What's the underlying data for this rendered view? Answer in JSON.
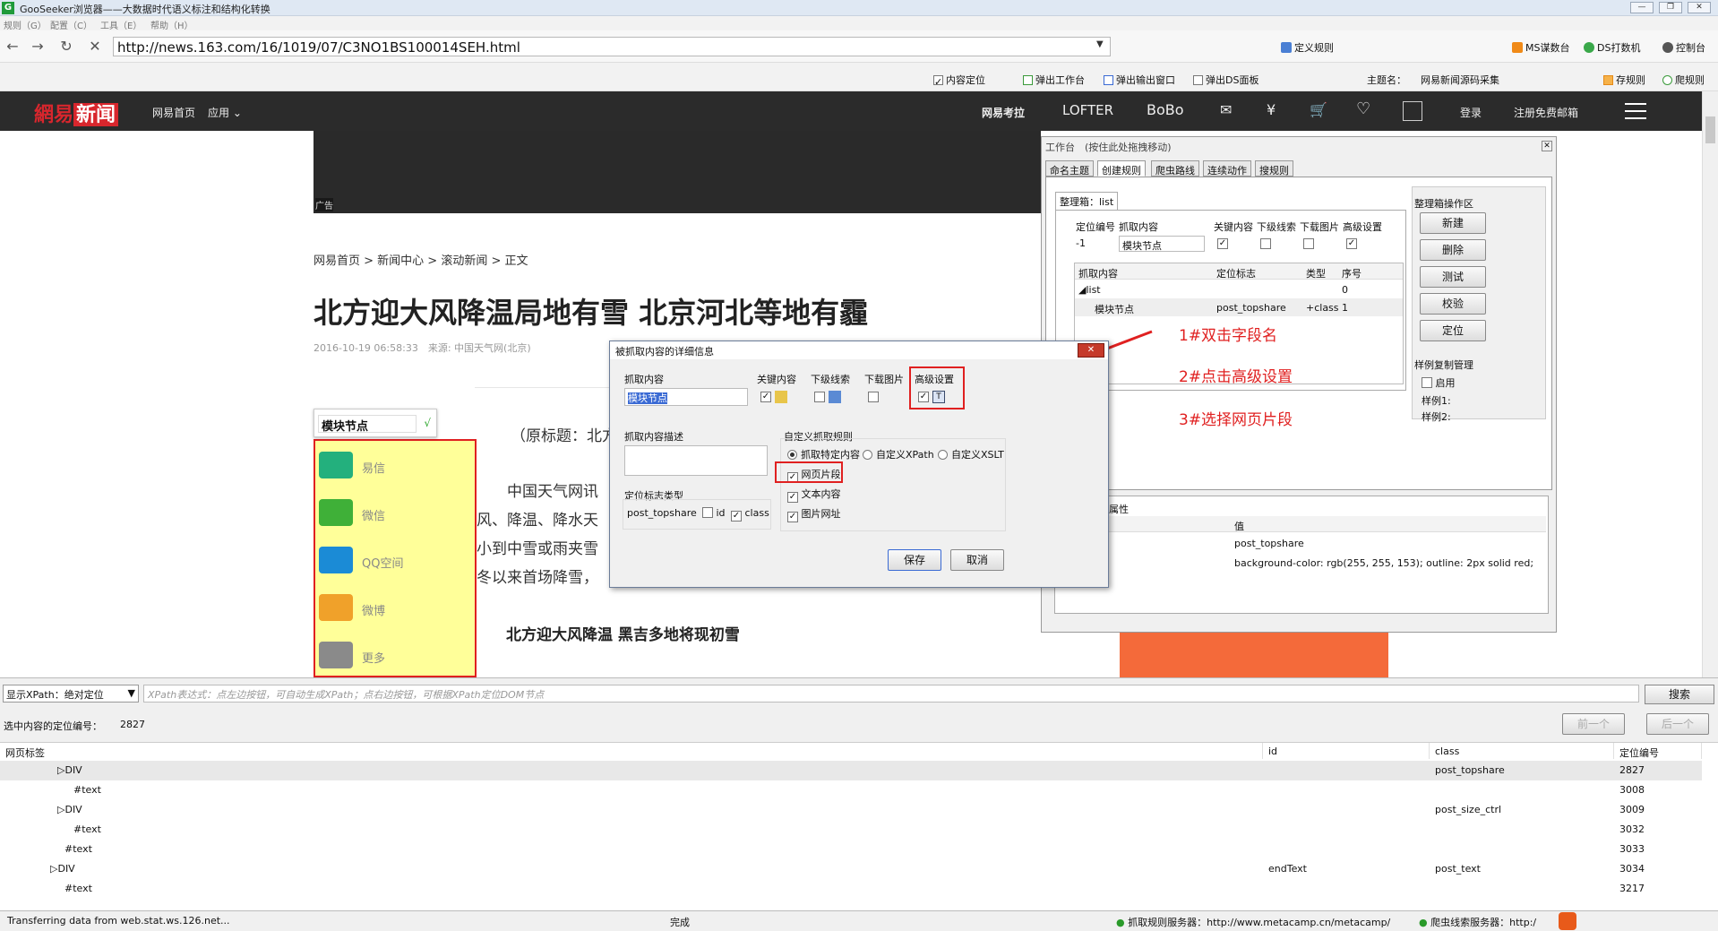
{
  "window": {
    "title": "GooSeeker浏览器——大数据时代语义标注和结构化转换",
    "app_icon": "G"
  },
  "menu": [
    "规则（G）",
    "配置（C）",
    "工具（E）",
    "帮助（H）"
  ],
  "address": {
    "url": "http://news.163.com/16/1019/07/C3NO1BS100014SEH.html",
    "define_rule": "定义规则"
  },
  "right_tools": {
    "ms": "MS谋数台",
    "ds": "DS打数机",
    "control": "控制台"
  },
  "toolbar2": {
    "content_locate": "内容定位",
    "popup_workbench": "弹出工作台",
    "popup_output": "弹出输出窗口",
    "popup_ds": "弹出DS面板",
    "theme_label": "主题名：",
    "theme_value": "网易新闻源码采集",
    "save_rule": "存规则",
    "crawl_rule": "爬规则"
  },
  "netease": {
    "logo_a": "網易",
    "logo_b": "新闻",
    "home": "网易首页",
    "apps": "应用",
    "right": [
      "网易考拉",
      "LOFTER",
      "BoBo",
      "✉",
      "¥",
      "🛒",
      "♡"
    ],
    "login": "登录",
    "register": "注册免费邮箱"
  },
  "article": {
    "ad_label": "广告",
    "breadcrumb": "网易首页 > 新闻中心 > 滚动新闻 > 正文",
    "headline": "北方迎大风降温局地有雪 北京河北等地有霾",
    "meta": "2016-10-19 06:58:33　来源: 中国天气网(北京)",
    "p1": "（原标题：北方",
    "p2": "中国天气网讯",
    "p3": "风、降温、降水天",
    "p4": "小到中雪或雨夹雪",
    "p5": "冬以来首场降雪，",
    "subhead": "北方迎大风降温 黑吉多地将现初雪"
  },
  "module_node": {
    "value": "模块节点",
    "check": "√"
  },
  "share": [
    {
      "label": "易信",
      "color": "#23b07d"
    },
    {
      "label": "微信",
      "color": "#3fb038"
    },
    {
      "label": "QQ空间",
      "color": "#1b8bd6"
    },
    {
      "label": "微博",
      "color": "#f0a12a"
    },
    {
      "label": "更多",
      "color": "#8a8a8a"
    }
  ],
  "workbench": {
    "title": "工作台　(按住此处拖拽移动)",
    "tabs": [
      "命名主题",
      "创建规则",
      "爬虫路线",
      "连续动作",
      "搜规则"
    ],
    "box_tab": "整理箱：list",
    "fields": {
      "loc_no": "定位编号",
      "capture": "抓取内容",
      "key": "关键内容",
      "sub": "下级线索",
      "img": "下载图片",
      "adv": "高级设置"
    },
    "loc_value": "-1",
    "capture_value": "模块节点",
    "table_headers": [
      "抓取内容",
      "定位标志",
      "类型",
      "序号"
    ],
    "rows": [
      {
        "name": "list",
        "flag": "",
        "type": "",
        "no": "0"
      },
      {
        "name": "模块节点",
        "flag": "post_topshare",
        "type": "+class",
        "no": "1"
      }
    ],
    "ops_title": "整理箱操作区",
    "ops": [
      "新建",
      "删除",
      "测试",
      "校验",
      "定位"
    ],
    "sample_title": "样例复制管理",
    "enable": "启用",
    "sample1": "样例1:",
    "sample2": "样例2:",
    "attr_title": "属性",
    "value_header": "值",
    "attr_values": [
      "post_topshare",
      "background-color: rgb(255, 255, 153); outline: 2px solid red;"
    ]
  },
  "annotations": [
    "1#双击字段名",
    "2#点击高级设置",
    "3#选择网页片段"
  ],
  "dialog": {
    "title": "被抓取内容的详细信息",
    "capture_label": "抓取内容",
    "capture_value": "模块节点",
    "key": "关键内容",
    "sub": "下级线索",
    "img": "下载图片",
    "adv": "高级设置",
    "desc_label": "抓取内容描述",
    "locflag_label": "定位标志类型",
    "locflag_value": "post_topshare",
    "id": "id",
    "class": "class",
    "custom_label": "自定义抓取规则",
    "opt_specific": "抓取特定内容",
    "opt_xpath": "自定义XPath",
    "opt_xslt": "自定义XSLT",
    "web_fragment": "网页片段",
    "text_content": "文本内容",
    "image_url": "图片网址",
    "save": "保存",
    "cancel": "取消"
  },
  "bottom": {
    "xpath_mode": "显示XPath：绝对定位",
    "xpath_placeholder": "XPath表达式：点左边按钮，可自动生成XPath；点右边按钮，可根据XPath定位DOM节点",
    "search": "搜索",
    "selected_label": "选中内容的定位编号：",
    "selected_value": "2827",
    "prev": "前一个",
    "next": "后一个",
    "headers": [
      "网页标签",
      "id",
      "class",
      "定位编号"
    ],
    "rows": [
      {
        "tag": "DIV",
        "indent": 64,
        "arrow": true,
        "id": "",
        "class": "post_topshare",
        "no": "2827"
      },
      {
        "tag": "#text",
        "indent": 72,
        "arrow": false,
        "id": "",
        "class": "",
        "no": "3008"
      },
      {
        "tag": "DIV",
        "indent": 64,
        "arrow": true,
        "id": "",
        "class": "post_size_ctrl",
        "no": "3009"
      },
      {
        "tag": "#text",
        "indent": 72,
        "arrow": false,
        "id": "",
        "class": "",
        "no": "3032"
      },
      {
        "tag": "#text",
        "indent": 62,
        "arrow": false,
        "id": "",
        "class": "",
        "no": "3033"
      },
      {
        "tag": "DIV",
        "indent": 56,
        "arrow": true,
        "id": "endText",
        "class": "post_text",
        "no": "3034"
      },
      {
        "tag": "#text",
        "indent": 62,
        "arrow": false,
        "id": "",
        "class": "",
        "no": "3217"
      }
    ]
  },
  "status": {
    "left": "Transferring data from web.stat.ws.126.net...",
    "done": "完成",
    "server1": "抓取规则服务器：http://www.metacamp.cn/metacamp/",
    "server2": "爬虫线索服务器：http:/"
  }
}
